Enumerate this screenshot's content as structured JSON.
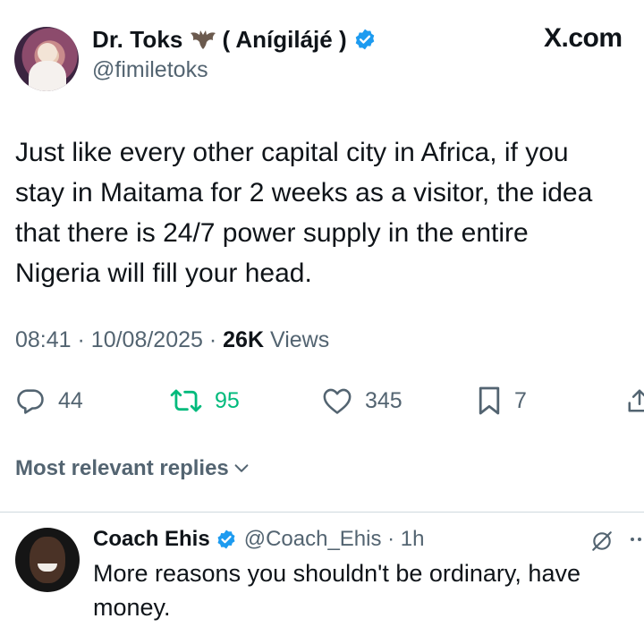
{
  "header": {
    "author_name": "Dr. Toks",
    "author_name_extra": "( Anígilájé )",
    "handle": "@fimiletoks",
    "site_label": "X.com"
  },
  "tweet": {
    "lines": [
      "Just like every other capital city in Africa, if you",
      "stay in Maitama for 2 weeks as a visitor, the idea",
      "that there is 24/7 power supply in the entire",
      "Nigeria will fill your head."
    ],
    "time": "08:41",
    "date": "10/08/2025",
    "views_count": "26K",
    "views_label": "Views"
  },
  "actions": {
    "replies": "44",
    "retweets": "95",
    "likes": "345",
    "bookmarks": "7"
  },
  "replies_section": {
    "label": "Most relevant replies"
  },
  "reply": {
    "name": "Coach Ehis",
    "handle_time": "@Coach_Ehis · 1h",
    "lines": [
      "More reasons you shouldn't be ordinary, have",
      "money."
    ]
  },
  "colors": {
    "verified": "#1d9bf0",
    "retweet": "#00ba7c",
    "secondary_text": "#536471",
    "primary_text": "#0f1419"
  }
}
